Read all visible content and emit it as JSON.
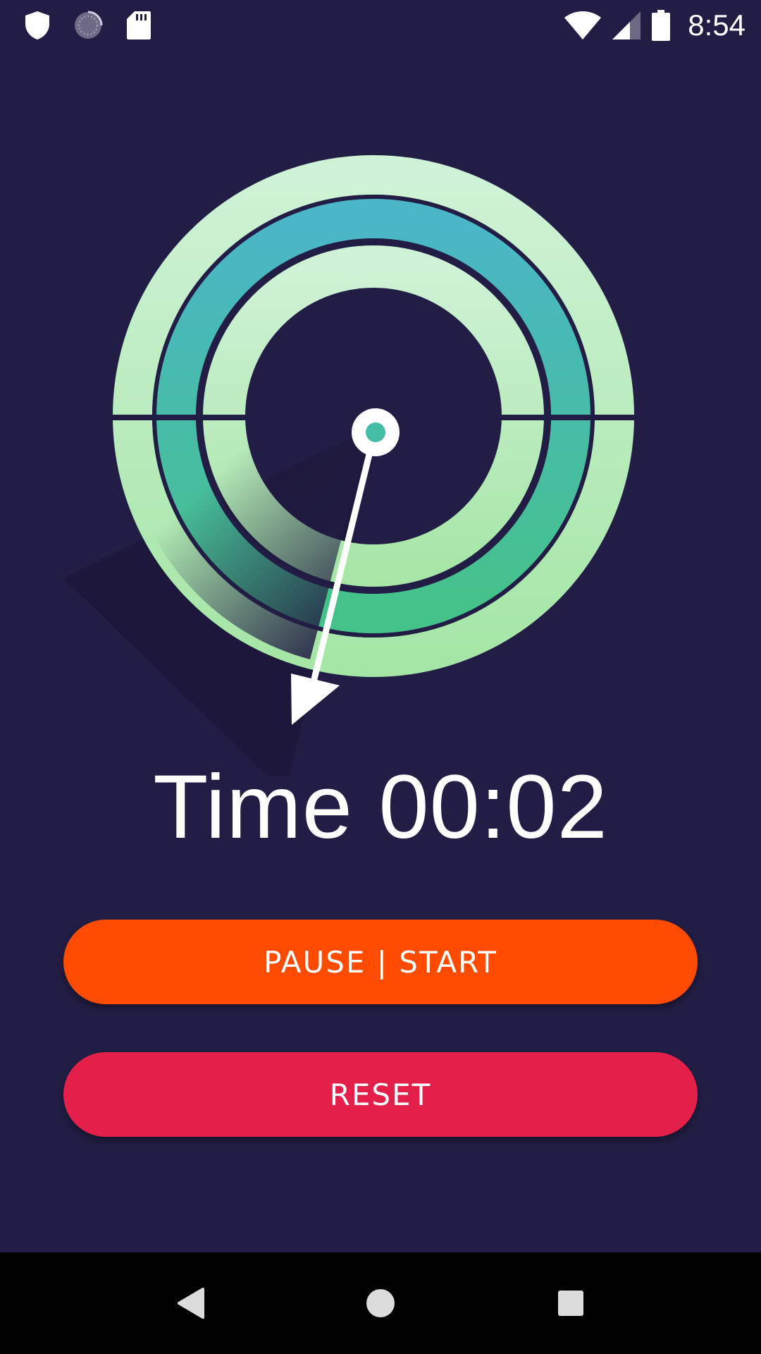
{
  "status_bar": {
    "time": "8:54",
    "left_icons": [
      "shield-icon",
      "loading-spinner-icon",
      "sd-card-icon"
    ],
    "right_icons": [
      "wifi-icon",
      "cell-signal-icon",
      "battery-icon"
    ]
  },
  "timer": {
    "label": "Time 00:02"
  },
  "buttons": {
    "pause_start": "PAUSE | START",
    "reset": "RESET"
  },
  "colors": {
    "background": "#221d44",
    "pause_button": "#ff4b00",
    "reset_button": "#e31f4a",
    "ring_light": "#c9f0d2",
    "ring_mid": "#4ab9c3",
    "ring_accent": "#47c08f",
    "hand": "#ffffff"
  },
  "nav_bar": {
    "icons": [
      "back-icon",
      "home-icon",
      "recents-icon"
    ]
  }
}
